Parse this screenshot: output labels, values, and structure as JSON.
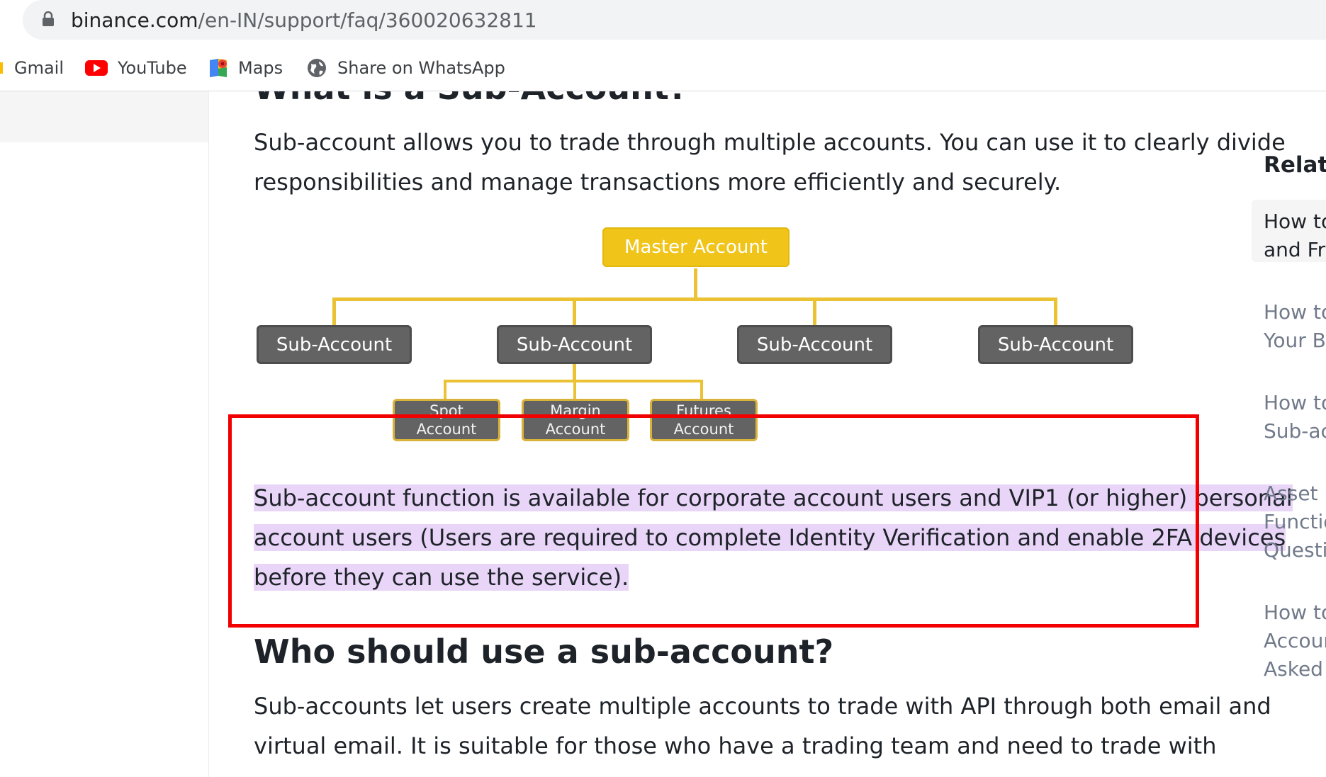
{
  "browser": {
    "url_host": "binance.com",
    "url_path": "/en-IN/support/faq/360020632811",
    "bookmarks": [
      {
        "label": "Gmail",
        "icon": "gmail-icon"
      },
      {
        "label": "YouTube",
        "icon": "youtube-icon"
      },
      {
        "label": "Maps",
        "icon": "maps-icon"
      },
      {
        "label": "Share on WhatsApp",
        "icon": "globe-icon"
      }
    ]
  },
  "article": {
    "heading_1": "What is a Sub-Account?",
    "intro_line_1": "Sub-account allows you to trade through multiple accounts. You can use it to clearly divide",
    "intro_line_2": "responsibilities and manage transactions more efficiently and securely.",
    "diagram": {
      "master": "Master Account",
      "subs": [
        "Sub-Account",
        "Sub-Account",
        "Sub-Account",
        "Sub-Account"
      ],
      "leaves": [
        {
          "line1": "Spot",
          "line2": "Account"
        },
        {
          "line1": "Margin",
          "line2": "Account"
        },
        {
          "line1": "Futures",
          "line2": "Account"
        }
      ]
    },
    "highlight_line_1": "Sub-account function is available for corporate account users and VIP1 (or higher) personal",
    "highlight_line_2": "account users (Users are required to complete Identity Verification and enable 2FA devices",
    "highlight_line_3": "before they can use the service).",
    "heading_2": "Who should use a sub-account?",
    "body_line_1": "Sub-accounts let users create multiple accounts to trade with API through both email and",
    "body_line_2": "virtual email. It is suitable for those who have a trading team and need to trade with"
  },
  "sidebar": {
    "title": "Relate",
    "items": [
      {
        "line1": "How to",
        "line2": "and Fre"
      },
      {
        "line1": "How to",
        "line2": "Your Bi"
      },
      {
        "line1": "How to",
        "line2": "Sub-ac"
      },
      {
        "line1": "Asset N",
        "line2": "Functio",
        "line3": "Questio"
      },
      {
        "line1": "How to",
        "line2": "Accour",
        "line3": "Asked C"
      }
    ]
  },
  "colors": {
    "highlight": "#e9d5f7",
    "annotation_box": "#f20000",
    "master_node": "#f0c419",
    "sub_node": "#636363",
    "connector": "#ecc235"
  }
}
